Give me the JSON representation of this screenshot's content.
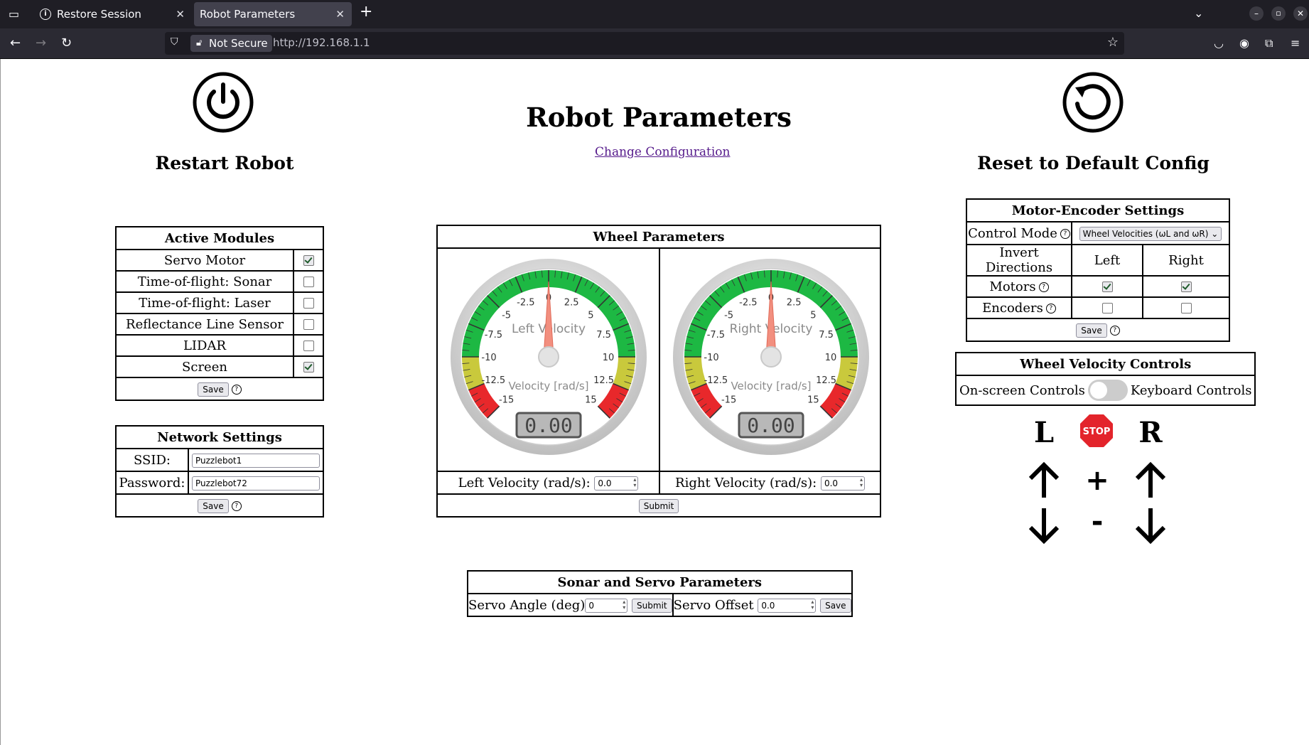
{
  "browser": {
    "tabs": [
      {
        "label": "Restore Session",
        "active": false
      },
      {
        "label": "Robot Parameters",
        "active": true
      }
    ],
    "not_secure_label": "Not Secure",
    "url": "http://192.168.1.1"
  },
  "page": {
    "title": "Robot Parameters",
    "change_config_link": "Change Configuration",
    "restart_label": "Restart Robot",
    "reset_label": "Reset to Default Config"
  },
  "active_modules": {
    "header": "Active Modules",
    "items": [
      {
        "label": "Servo Motor",
        "checked": true
      },
      {
        "label": "Time-of-flight: Sonar",
        "checked": false
      },
      {
        "label": "Time-of-flight: Laser",
        "checked": false
      },
      {
        "label": "Reflectance Line Sensor",
        "checked": false
      },
      {
        "label": "LIDAR",
        "checked": false
      },
      {
        "label": "Screen",
        "checked": true
      }
    ],
    "save_label": "Save"
  },
  "network": {
    "header": "Network Settings",
    "ssid_label": "SSID:",
    "ssid_value": "Puzzlebot1",
    "password_label": "Password:",
    "password_value": "Puzzlebot72",
    "save_label": "Save"
  },
  "wheel_params": {
    "header": "Wheel Parameters",
    "left_gauge": {
      "title": "Left Velocity",
      "units": "Velocity [rad/s]",
      "value": 0.0,
      "display": "0.00",
      "min": -15,
      "max": 15
    },
    "right_gauge": {
      "title": "Right Velocity",
      "units": "Velocity [rad/s]",
      "value": 0.0,
      "display": "0.00",
      "min": -15,
      "max": 15
    },
    "ticks": [
      "-15",
      "-12.5",
      "-10",
      "-7.5",
      "-5",
      "-2.5",
      "0",
      "2.5",
      "5",
      "7.5",
      "10",
      "12.5",
      "15"
    ],
    "left_label": "Left Velocity (rad/s):",
    "left_value": "0.0",
    "right_label": "Right Velocity (rad/s):",
    "right_value": "0.0",
    "submit_label": "Submit"
  },
  "sonar_servo": {
    "header": "Sonar and Servo Parameters",
    "angle_label": "Servo Angle (deg)",
    "angle_value": "0",
    "submit_label": "Submit",
    "offset_label": "Servo Offset",
    "offset_value": "0.0",
    "save_label": "Save"
  },
  "motor_encoder": {
    "header": "Motor-Encoder Settings",
    "control_mode_label": "Control Mode",
    "control_mode_value": "Wheel Velocities (ωL and ωR)",
    "invert_label": "Invert Directions",
    "left_label": "Left",
    "right_label": "Right",
    "motors_label": "Motors",
    "motors_left": true,
    "motors_right": true,
    "encoders_label": "Encoders",
    "encoders_left": false,
    "encoders_right": false,
    "save_label": "Save"
  },
  "velocity_controls": {
    "header": "Wheel Velocity Controls",
    "onscreen_label": "On-screen Controls",
    "keyboard_label": "Keyboard Controls",
    "left_letter": "L",
    "right_letter": "R",
    "stop_label": "STOP",
    "plus_label": "+",
    "minus_label": "-"
  },
  "colors": {
    "accent_green": "#1db843",
    "gauge_red": "#e8282b",
    "gauge_yellow": "#c9c93c",
    "stop_red": "#e3242b"
  }
}
